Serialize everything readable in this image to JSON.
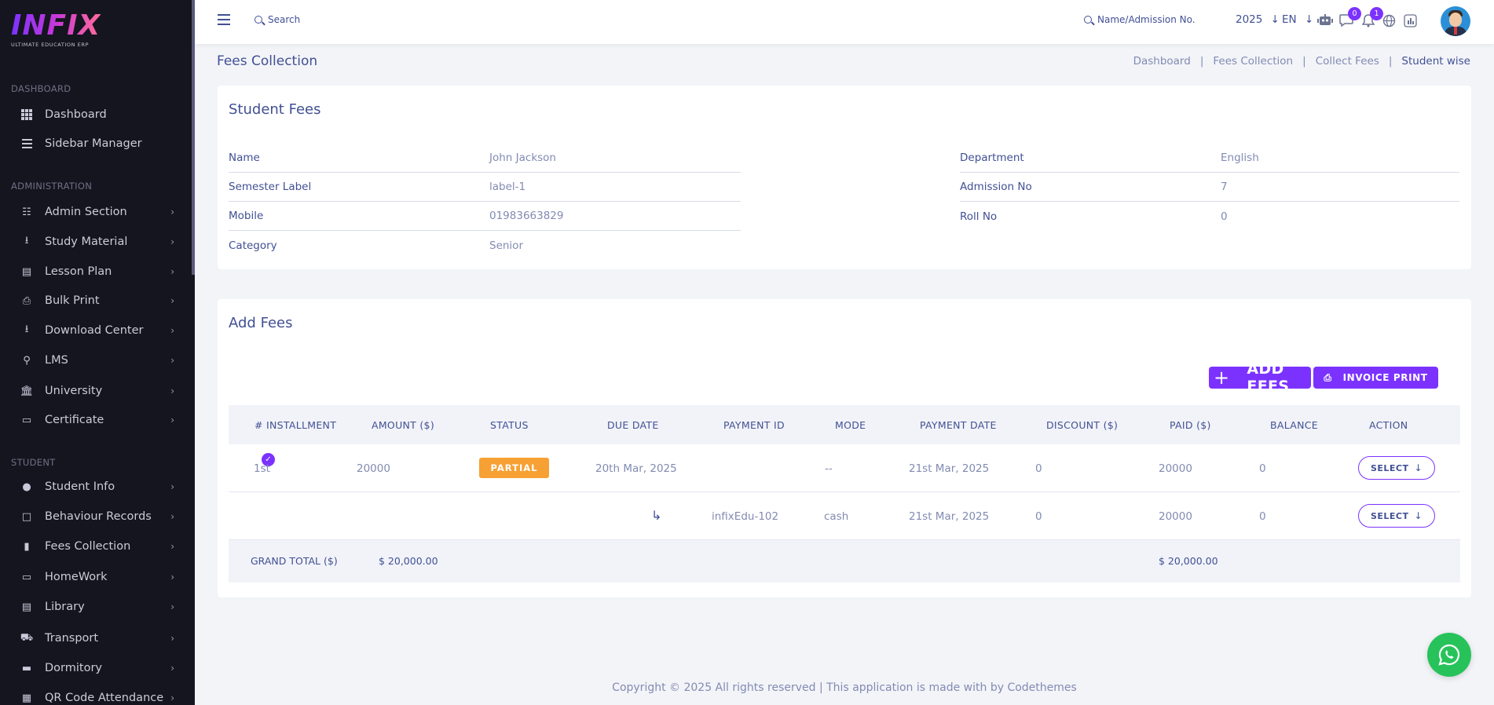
{
  "app": {
    "logo_text": "INFIX",
    "logo_subtitle": "ULTIMATE EDUCATION ERP"
  },
  "sidebar": {
    "sections": [
      {
        "title": "DASHBOARD"
      },
      {
        "title": "ADMINISTRATION"
      },
      {
        "title": "STUDENT"
      }
    ],
    "items": [
      {
        "label": "Dashboard",
        "icon": "grid-icon"
      },
      {
        "label": "Sidebar Manager",
        "icon": "menu-icon"
      },
      {
        "label": "Admin Section",
        "icon": "admin-icon"
      },
      {
        "label": "Study Material",
        "icon": "download-icon"
      },
      {
        "label": "Lesson Plan",
        "icon": "list-icon"
      },
      {
        "label": "Bulk Print",
        "icon": "printer-icon"
      },
      {
        "label": "Download Center",
        "icon": "download-icon"
      },
      {
        "label": "LMS",
        "icon": "lms-icon"
      },
      {
        "label": "University",
        "icon": "university-icon"
      },
      {
        "label": "Certificate",
        "icon": "book-icon"
      },
      {
        "label": "Student Info",
        "icon": "user-icon"
      },
      {
        "label": "Behaviour Records",
        "icon": "records-icon"
      },
      {
        "label": "Fees Collection",
        "icon": "fees-icon"
      },
      {
        "label": "HomeWork",
        "icon": "book-icon"
      },
      {
        "label": "Library",
        "icon": "library-icon"
      },
      {
        "label": "Transport",
        "icon": "bus-icon"
      },
      {
        "label": "Dormitory",
        "icon": "bed-icon"
      },
      {
        "label": "QR Code Attendance",
        "icon": "qr-icon"
      }
    ]
  },
  "topbar": {
    "search_label": "Search",
    "student_search_label": "Name/Admission No.",
    "year": "2025",
    "language": "EN",
    "messages_count": "0",
    "notifications_count": "1"
  },
  "page": {
    "title": "Fees Collection",
    "breadcrumb": [
      "Dashboard",
      "Fees Collection",
      "Collect Fees",
      "Student wise"
    ]
  },
  "student_fees": {
    "title": "Student Fees",
    "left": [
      {
        "label": "Name",
        "value": "John Jackson"
      },
      {
        "label": "Semester Label",
        "value": "label-1"
      },
      {
        "label": "Mobile",
        "value": "01983663829"
      },
      {
        "label": "Category",
        "value": "Senior"
      }
    ],
    "right": [
      {
        "label": "Department",
        "value": "English"
      },
      {
        "label": "Admission No",
        "value": "7"
      },
      {
        "label": "Roll No",
        "value": "0"
      }
    ]
  },
  "add_fees": {
    "title": "Add Fees",
    "add_button": "ADD FEES",
    "print_button": "INVOICE PRINT",
    "columns": [
      "# INSTALLMENT",
      "AMOUNT ($)",
      "STATUS",
      "DUE DATE",
      "PAYMENT ID",
      "MODE",
      "PAYMENT DATE",
      "DISCOUNT ($)",
      "PAID ($)",
      "BALANCE",
      "ACTION"
    ],
    "rows": [
      {
        "installment": "1st",
        "amount": "20000",
        "status": "PARTIAL",
        "due_date": "20th Mar, 2025",
        "payment_id": "",
        "mode": "--",
        "payment_date": "21st Mar, 2025",
        "discount": "0",
        "paid": "20000",
        "balance": "0",
        "action": "SELECT"
      },
      {
        "installment": "",
        "amount": "",
        "status": "",
        "due_date": "",
        "payment_id": "infixEdu-102",
        "mode": "cash",
        "payment_date": "21st Mar, 2025",
        "discount": "0",
        "paid": "20000",
        "balance": "0",
        "action": "SELECT"
      }
    ],
    "grand_total_label": "GRAND TOTAL ($)",
    "grand_total_amount": "$ 20,000.00",
    "grand_total_paid": "$ 20,000.00"
  },
  "footer": {
    "text": "Copyright © 2025 All rights reserved | This application is made with by Codethemes"
  },
  "colors": {
    "primary": "#7c32ff",
    "sidebar_bg": "#15151f",
    "text": "#415094",
    "muted": "#828bb2",
    "partial": "#f7a033",
    "whatsapp": "#27c35a"
  }
}
